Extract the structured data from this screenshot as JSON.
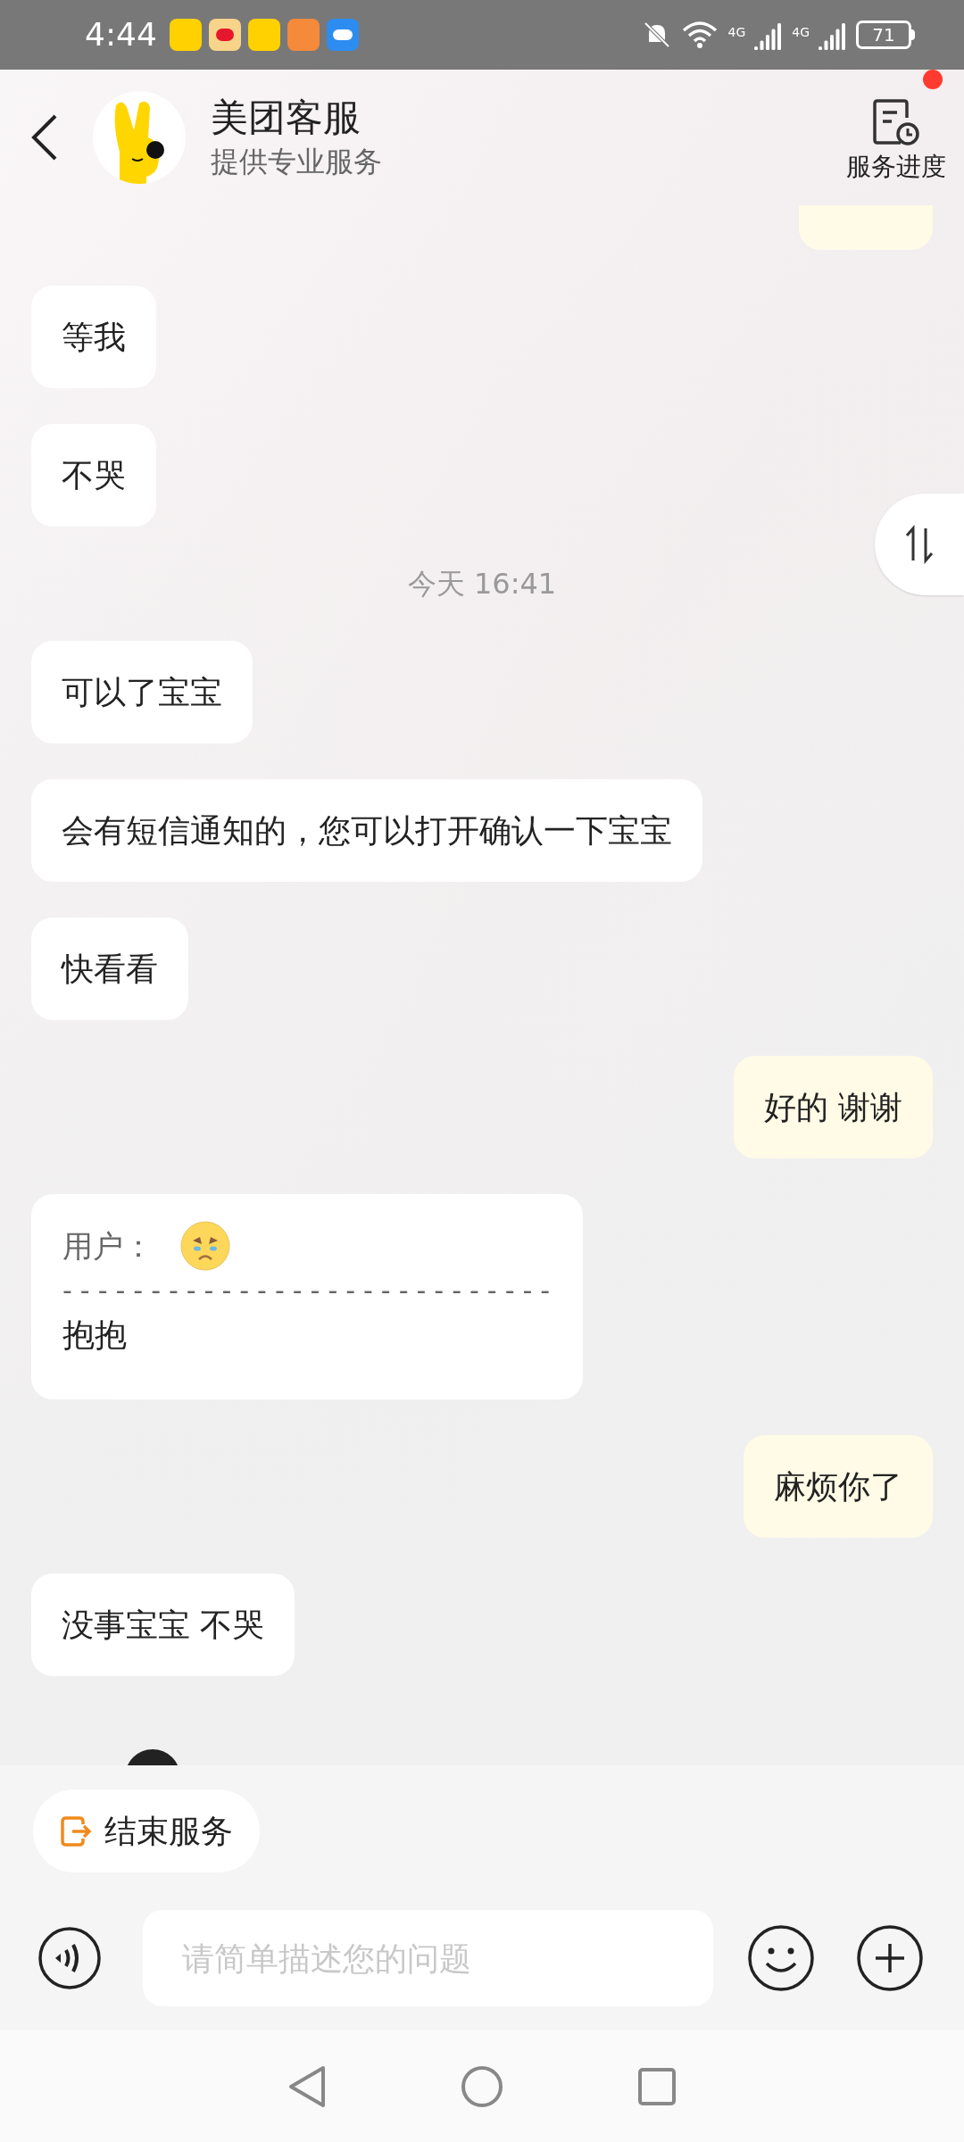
{
  "status_bar": {
    "time": "4:44",
    "network_1": "4G",
    "network_2": "4G",
    "battery": "71"
  },
  "header": {
    "title": "美团客服",
    "subtitle": "提供专业服务",
    "progress_label": "服务进度",
    "has_notification": true
  },
  "messages": [
    {
      "kind": "clipped",
      "outgoing": true
    },
    {
      "kind": "text",
      "outgoing": false,
      "text": "等我"
    },
    {
      "kind": "text",
      "outgoing": false,
      "text": "不哭"
    },
    {
      "kind": "time",
      "text": "今天 16:41"
    },
    {
      "kind": "text",
      "outgoing": false,
      "text": "可以了宝宝"
    },
    {
      "kind": "text",
      "outgoing": false,
      "text": "会有短信通知的，您可以打开确认一下宝宝"
    },
    {
      "kind": "text",
      "outgoing": false,
      "text": "快看看"
    },
    {
      "kind": "text",
      "outgoing": true,
      "text": "好的 谢谢"
    },
    {
      "kind": "quote",
      "outgoing": false,
      "label": "用户：",
      "divider": "----------------------------",
      "text": "抱抱"
    },
    {
      "kind": "text",
      "outgoing": true,
      "text": "麻烦你了"
    },
    {
      "kind": "text",
      "outgoing": false,
      "text": "没事宝宝 不哭"
    },
    {
      "kind": "avatar"
    }
  ],
  "end_service": {
    "label": "结束服务"
  },
  "input": {
    "placeholder": "请简单描述您的问题"
  }
}
